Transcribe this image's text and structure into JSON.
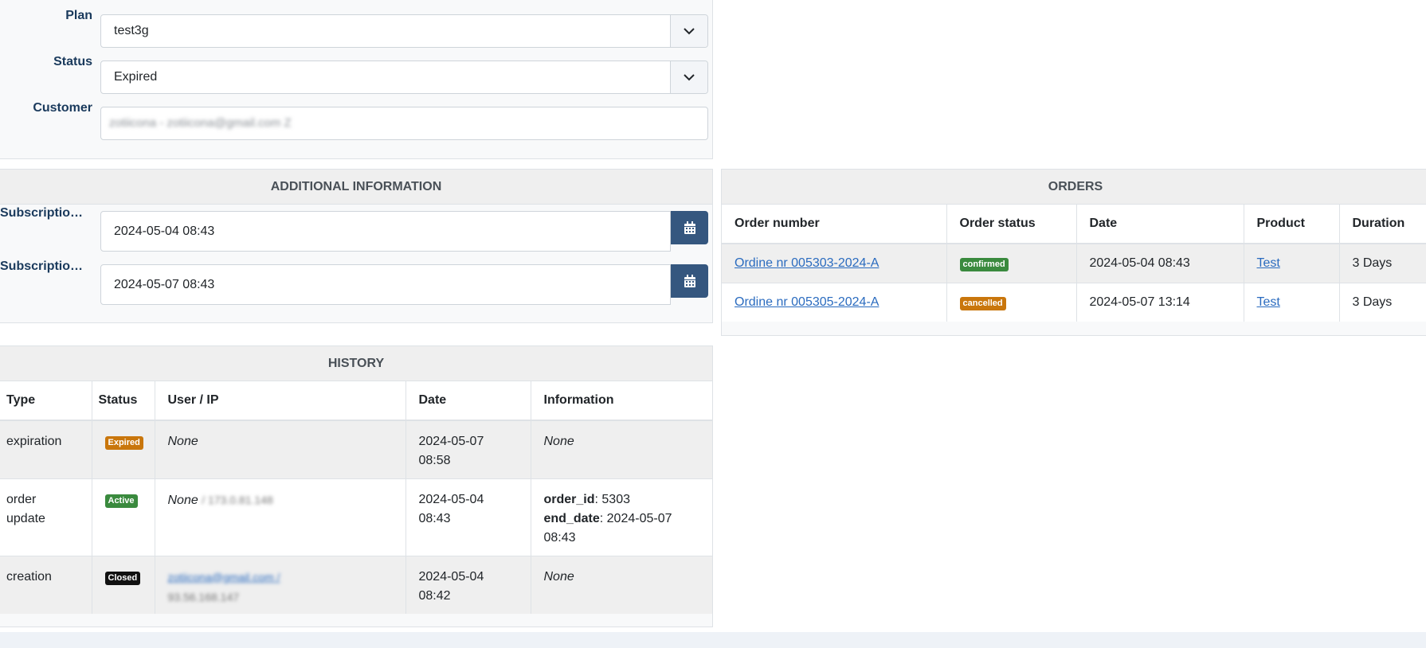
{
  "form": {
    "plan_label": "Plan",
    "plan_value": "test3g",
    "status_label": "Status",
    "status_value": "Expired",
    "customer_label": "Customer",
    "customer_value": "zotiicona - zotiicona@gmail.com Z"
  },
  "additional_info": {
    "title": "ADDITIONAL INFORMATION",
    "start_label": "Subscription s...",
    "start_value": "2024-05-04 08:43",
    "end_label": "Subscription e...",
    "end_value": "2024-05-07 08:43"
  },
  "orders": {
    "title": "ORDERS",
    "columns": [
      "Order number",
      "Order status",
      "Date",
      "Product",
      "Duration"
    ],
    "rows": [
      {
        "number": "Ordine nr 005303-2024-A",
        "status": "confirmed",
        "status_color": "#3a8a3e",
        "date": "2024-05-04 08:43",
        "product": "Test",
        "duration": "3 Days"
      },
      {
        "number": "Ordine nr 005305-2024-A",
        "status": "cancelled",
        "status_color": "#c9760c",
        "date": "2024-05-07 13:14",
        "product": "Test",
        "duration": "3 Days"
      }
    ]
  },
  "history": {
    "title": "HISTORY",
    "columns": [
      "Type",
      "Status",
      "User / IP",
      "Date",
      "Information"
    ],
    "rows": [
      {
        "type": "expiration",
        "status": "Expired",
        "status_color": "#c9760c",
        "user": "None",
        "ip": "",
        "date": "2024-05-07 08:58",
        "info": "None"
      },
      {
        "type": "order update",
        "status": "Active",
        "status_color": "#3a8a3e",
        "user": "None",
        "ip": "/ 173.0.81.148",
        "date": "2024-05-04 08:43",
        "info_order_id_label": "order_id",
        "info_order_id": ": 5303",
        "info_end_date_label": "end_date",
        "info_end_date": ": 2024-05-07 08:43"
      },
      {
        "type": "creation",
        "status": "Closed",
        "status_color": "#111111",
        "user_email": "zotiicona@gmail.com /",
        "ip": "93.56.168.147",
        "date": "2024-05-04 08:42",
        "info": "None"
      }
    ]
  },
  "colors": {
    "accent": "#35577f",
    "link": "#2a6bbf",
    "footer": "#eef2f7"
  },
  "icons": {
    "dropdown": "chevron-down-icon",
    "calendar": "calendar-icon"
  }
}
